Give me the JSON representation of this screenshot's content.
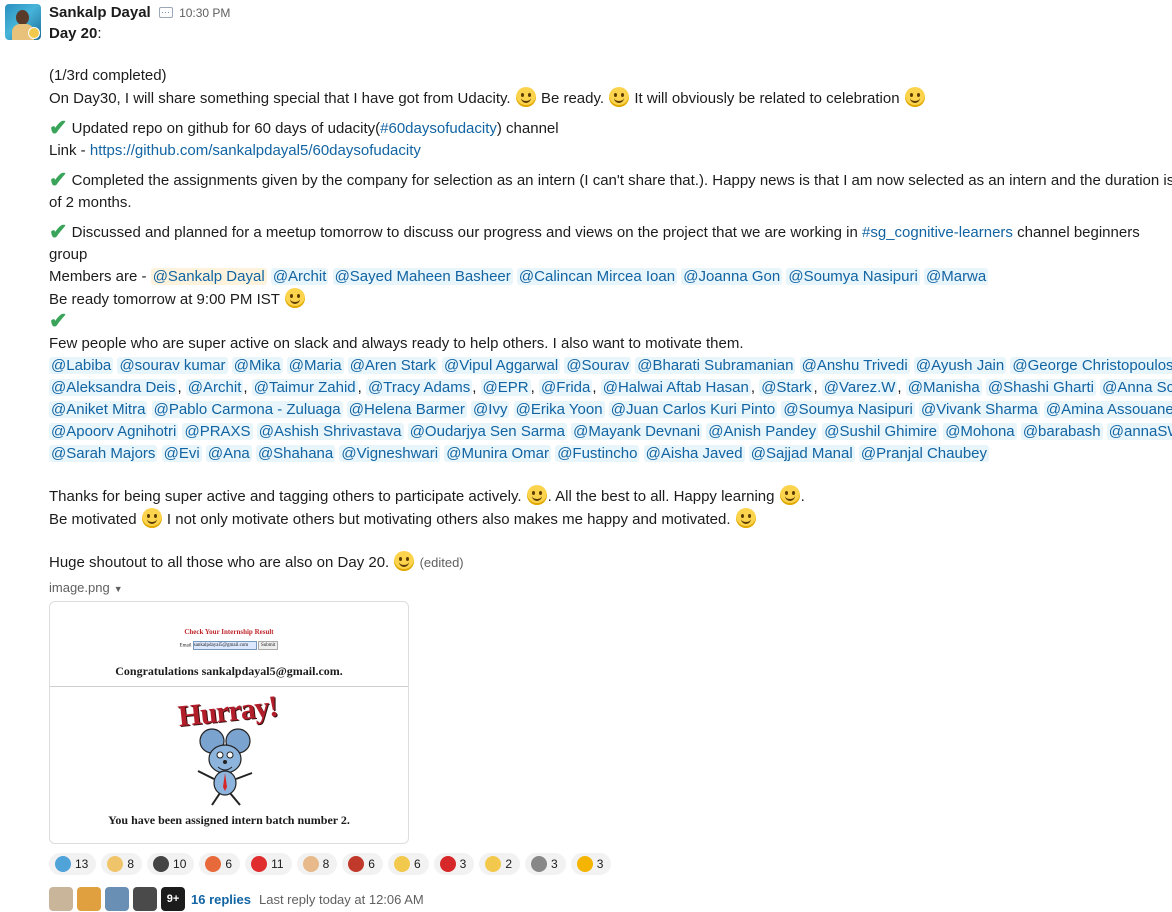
{
  "author": {
    "name": "Sankalp Dayal",
    "time": "10:30 PM"
  },
  "lines": {
    "day": "Day 20",
    "day_suffix": ":",
    "progress": "(1/3rd completed)",
    "l1a": "On Day30, I will share something special that I have got from Udacity.",
    "l1b": " Be ready.",
    "l1c": " It will obviously be related to  celebration",
    "repo": " Updated repo on github for 60 days of udacity(",
    "repo_channel": "#60daysofudacity",
    "repo_end": ")  channel",
    "link_prefix": "Link - ",
    "link_url": "https://github.com/sankalpdayal5/60daysofudacity",
    "assign1": " Completed the assignments given by the company for selection as an intern (I can't share that.). Happy news is that I am now selected as an intern and the duration is",
    "assign2": "of 2 months.",
    "meetup1": "  Discussed and planned for a meetup tomorrow to discuss our progress and views on the project that we are working in ",
    "meetup_channel": "#sg_cognitive-learners",
    "meetup_end": " channel beginners",
    "meetup2": "group",
    "members_prefix": "Members are - ",
    "ready": "Be ready tomorrow at 9:00 PM IST",
    "few": "Few people who are super active on slack and always ready to help others. I also want to motivate them.",
    "thanks_a": "Thanks for being super active and tagging others to participate actively. ",
    "thanks_b": ". All the best to all. Happy learning ",
    "thanks_c": ".",
    "motivated_a": "Be motivated ",
    "motivated_b": " I not only motivate others but motivating others also makes me happy and motivated. ",
    "shoutout": "Huge shoutout to all those who are also on Day 20. ",
    "edited": "(edited)"
  },
  "members": [
    "@Sankalp Dayal",
    "@Archit",
    "@Sayed Maheen Basheer",
    "@Calincan Mircea Ioan",
    "@Joanna Gon",
    "@Soumya Nasipuri",
    "@Marwa"
  ],
  "mention_rows": [
    [
      "@Labiba",
      "@sourav kumar",
      "@Mika",
      "@Maria",
      "@Aren Stark",
      "@Vipul Aggarwal",
      "@Sourav",
      "@Bharati Subramanian",
      "@Anshu Trivedi",
      "@Ayush Jain",
      "@George Christopoulos",
      ","
    ],
    [
      "@Aleksandra Deis",
      ",",
      "@Archit",
      ",",
      "@Taimur Zahid",
      ",",
      "@Tracy Adams",
      ",",
      "@EPR",
      ",",
      "@Frida",
      ",",
      "@Halwai Aftab Hasan",
      ",",
      "@Stark",
      ",",
      "@Varez.W",
      ",",
      "@Manisha",
      "@Shashi Gharti",
      "@Anna Scott"
    ],
    [
      "@Aniket Mitra",
      "@Pablo Carmona - Zuluaga",
      "@Helena Barmer",
      "@Ivy",
      "@Erika Yoon",
      "@Juan Carlos Kuri Pinto",
      "@Soumya Nasipuri",
      "@Vivank Sharma",
      "@Amina Assouane"
    ],
    [
      "@Apoorv Agnihotri",
      "@PRAXS",
      "@Ashish Shrivastava",
      "@Oudarjya Sen Sarma",
      "@Mayank Devnani",
      "@Anish Pandey",
      "@Sushil Ghimire",
      "@Mohona",
      "@barabash",
      "@annaSWE"
    ],
    [
      "@Sarah Majors",
      "@Evi",
      "@Ana",
      "@Shahana",
      "@Vigneshwari",
      "@Munira Omar",
      "@Fustincho",
      "@Aisha Javed",
      "@Sajjad Manal",
      "@Pranjal Chaubey"
    ]
  ],
  "file": {
    "name": "image.png"
  },
  "image": {
    "form_title": "Check Your Internship Result",
    "email_label": "Email",
    "email_value": "sankalpdayal5@gmail.com",
    "submit": "Submit",
    "congrats": "Congratulations sankalpdayal5@gmail.com.",
    "hurray": "Hurray!",
    "batch": "You have been assigned intern batch number 2."
  },
  "reactions": [
    {
      "icon": "thank-you-icon",
      "count": "13",
      "color": "#4fa3d9"
    },
    {
      "icon": "clapping-icon",
      "count": "8",
      "color": "#f0c46a"
    },
    {
      "icon": "penguin-icon",
      "count": "10",
      "color": "#444444"
    },
    {
      "icon": "party-popper-icon",
      "count": "6",
      "color": "#e86a3a"
    },
    {
      "icon": "fire-icon",
      "count": "11",
      "color": "#e02d2d"
    },
    {
      "icon": "clap-hands-icon",
      "count": "8",
      "color": "#e8b98a"
    },
    {
      "icon": "tent-icon",
      "count": "6",
      "color": "#c0392b"
    },
    {
      "icon": "victory-hand-icon",
      "count": "6",
      "color": "#f2c94c"
    },
    {
      "icon": "a-badge-icon",
      "count": "3",
      "color": "#d62828"
    },
    {
      "icon": "raised-hands-icon",
      "count": "2",
      "color": "#f2c94c"
    },
    {
      "icon": "dancing-icon",
      "count": "3",
      "color": "#888888"
    },
    {
      "icon": "star-struck-icon",
      "count": "3",
      "color": "#f4b400"
    }
  ],
  "thread": {
    "more": "9+",
    "replies": "16 replies",
    "last_reply": "Last reply today at 12:06 AM"
  }
}
